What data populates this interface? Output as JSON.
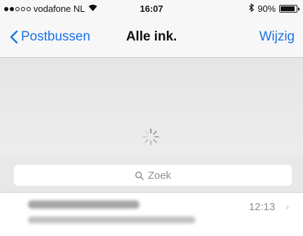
{
  "status_bar": {
    "carrier": "vodafone NL",
    "time": "16:07",
    "battery_text": "90%",
    "battery_level": 0.9,
    "signal_bars_filled": 2,
    "signal_bars_total": 5
  },
  "nav": {
    "back_label": "Postbussen",
    "title": "Alle ink.",
    "edit_label": "Wijzig"
  },
  "search": {
    "placeholder": "Zoek"
  },
  "mail_list": [
    {
      "time": "12:13",
      "chevron": "›"
    }
  ],
  "colors": {
    "accent": "#1a73e8"
  },
  "icons": {
    "back": "chevron-left-icon",
    "search": "magnifier-icon",
    "refresh": "spinner-icon"
  }
}
